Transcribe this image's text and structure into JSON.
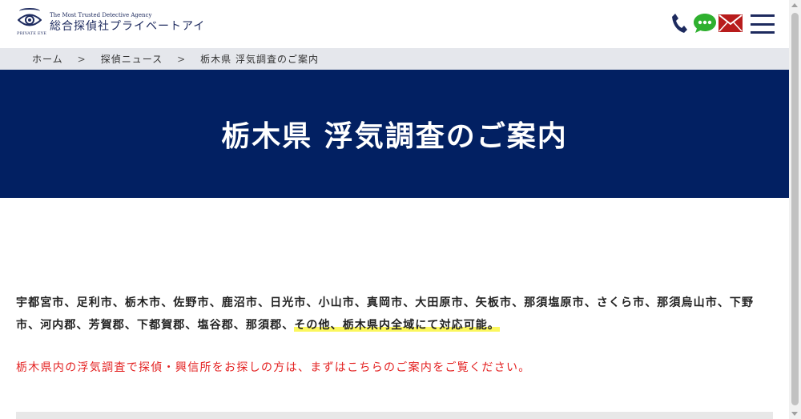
{
  "header": {
    "logo_caption": "PRIVATE EYE",
    "logo_tagline": "The Most Trusted Detective Agency",
    "logo_name": "総合探偵社プライベートアイ",
    "icons": [
      "phone-icon",
      "chat-icon",
      "mail-icon",
      "hamburger-menu-icon"
    ],
    "colors": {
      "navy": "#1d2a5e",
      "chat_green": "#2fb02f",
      "mail_red": "#b81c1c"
    }
  },
  "breadcrumb": {
    "home": "ホーム",
    "sep1": ">",
    "news": "探偵ニュース",
    "sep2": ">",
    "current": "栃木県 浮気調査のご案内"
  },
  "hero": {
    "title": "栃木県 浮気調査のご案内",
    "background": "#022062"
  },
  "content": {
    "cities": "宇都宮市、足利市、栃木市、佐野市、鹿沼市、日光市、小山市、真岡市、大田原市、矢板市、那須塩原市、さくら市、那須烏山市、下野市、河内郡、芳賀郡、下都賀郡、塩谷郡、那須郡、",
    "cities_highlight": "その他、栃木県内全域にて対応可能。",
    "notice": "栃木県内の浮気調査で探偵・興信所をお探しの方は、まずはこちらのご案内をご覧ください。",
    "notice_color": "#e31f1f",
    "highlight_color": "#fbf75d"
  }
}
